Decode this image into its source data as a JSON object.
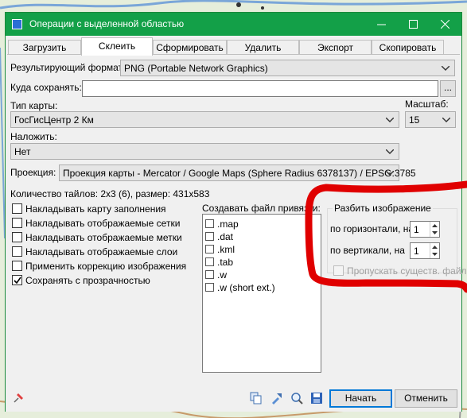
{
  "window": {
    "title": "Операции с выделенной областью"
  },
  "tabs": [
    {
      "label": "Загрузить"
    },
    {
      "label": "Склеить"
    },
    {
      "label": "Сформировать"
    },
    {
      "label": "Удалить"
    },
    {
      "label": "Экспорт"
    },
    {
      "label": "Скопировать"
    }
  ],
  "form": {
    "format_label": "Результирующий формат:",
    "format_value": "PNG (Portable Network Graphics)",
    "save_to_label": "Куда сохранять:",
    "save_to_value": "",
    "browse_label": "...",
    "map_type_label": "Тип карты:",
    "map_type_value": "ГосГисЦентр 2 Км",
    "zoom_label": "Масштаб:",
    "zoom_value": "15",
    "overlay_label": "Наложить:",
    "overlay_value": "Нет",
    "projection_label": "Проекция:",
    "projection_value": "Проекция карты - Mercator / Google Maps (Sphere Radius 6378137) / EPSG:3785",
    "tiles_info": "Количество тайлов: 2x3 (6), размер: 431x583"
  },
  "options": [
    {
      "label": "Накладывать карту заполнения",
      "checked": false
    },
    {
      "label": "Накладывать отображаемые сетки",
      "checked": false
    },
    {
      "label": "Накладывать отображаемые метки",
      "checked": false
    },
    {
      "label": "Накладывать отображаемые слои",
      "checked": false
    },
    {
      "label": "Применить коррекцию изображения",
      "checked": false
    },
    {
      "label": "Сохранять с прозрачностью",
      "checked": true
    }
  ],
  "georef": {
    "label": "Создавать файл привязки:",
    "items": [
      {
        "label": ".map",
        "checked": false
      },
      {
        "label": ".dat",
        "checked": false
      },
      {
        "label": ".kml",
        "checked": false
      },
      {
        "label": ".tab",
        "checked": false
      },
      {
        "label": ".w",
        "checked": false
      },
      {
        "label": ".w (short ext.)",
        "checked": false
      }
    ]
  },
  "split": {
    "legend": "Разбить изображение",
    "horizontal_label": "по горизонтали, на",
    "horizontal_value": "1",
    "vertical_label": "по вертикали, на",
    "vertical_value": "1",
    "skip_label": "Пропускать существ. файл"
  },
  "buttons": {
    "start": "Начать",
    "cancel": "Отменить"
  },
  "colors": {
    "titlebar": "#13a048",
    "accent": "#0078d7",
    "annotation": "#e00000"
  }
}
